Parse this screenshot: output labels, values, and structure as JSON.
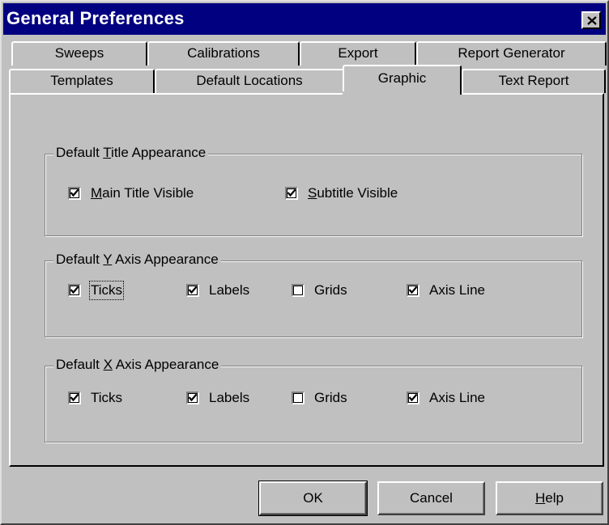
{
  "window": {
    "title": "General Preferences",
    "colors": {
      "titlebar": "#000080",
      "face": "#c0c0c0"
    }
  },
  "tabs": {
    "row1": [
      {
        "label": "Sweeps"
      },
      {
        "label": "Calibrations"
      },
      {
        "label": "Export"
      },
      {
        "label": "Report Generator"
      }
    ],
    "row2": [
      {
        "label": "Templates"
      },
      {
        "label": "Default Locations"
      },
      {
        "label": "Graphic",
        "selected": true
      },
      {
        "label": "Text Report"
      }
    ]
  },
  "groups": {
    "title": {
      "label_pre": "Default ",
      "label_accel": "T",
      "label_post": "itle Appearance",
      "items": [
        {
          "accel": "M",
          "rest": "ain Title Visible",
          "checked": true
        },
        {
          "accel": "S",
          "rest": "ubtitle Visible",
          "checked": true
        }
      ]
    },
    "yaxis": {
      "label_pre": "Default ",
      "label_accel": "Y",
      "label_post": " Axis Appearance",
      "items": [
        {
          "label": "Ticks",
          "checked": true,
          "focused": true
        },
        {
          "label": "Labels",
          "checked": true
        },
        {
          "label": "Grids",
          "checked": false
        },
        {
          "label": "Axis Line",
          "checked": true
        }
      ]
    },
    "xaxis": {
      "label_pre": "Default ",
      "label_accel": "X",
      "label_post": " Axis Appearance",
      "items": [
        {
          "label": "Ticks",
          "checked": true
        },
        {
          "label": "Labels",
          "checked": true
        },
        {
          "label": "Grids",
          "checked": false
        },
        {
          "label": "Axis Line",
          "checked": true
        }
      ]
    }
  },
  "buttons": {
    "ok": "OK",
    "cancel": "Cancel",
    "help_accel": "H",
    "help_rest": "elp"
  }
}
